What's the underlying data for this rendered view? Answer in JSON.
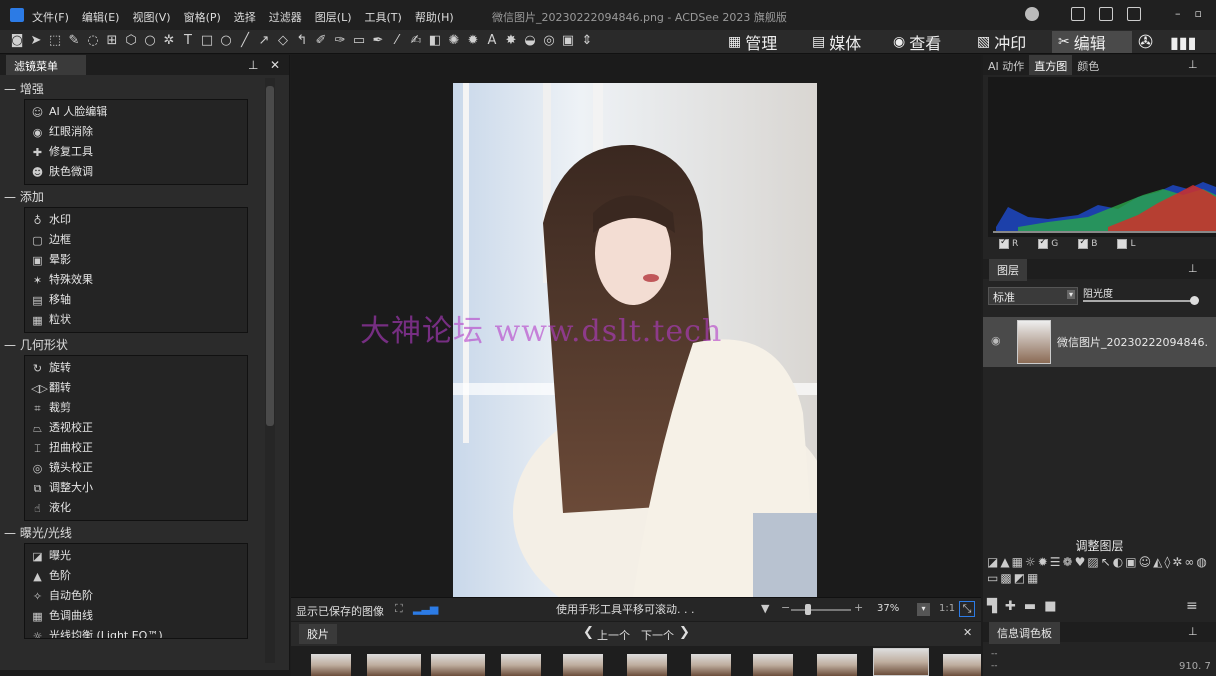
{
  "menubar": {
    "items": [
      "文件(F)",
      "编辑(E)",
      "视图(V)",
      "窗格(P)",
      "选择",
      "过滤器",
      "图层(L)",
      "工具(T)",
      "帮助(H)"
    ],
    "window_title": "微信图片_20230222094846.png - ACDSee 2023 旗舰版"
  },
  "modes": {
    "manage": "管理",
    "media": "媒体",
    "view": "查看",
    "develop": "冲印",
    "edit": "编辑"
  },
  "left_panel": {
    "tab": "滤镜菜单",
    "sections": [
      {
        "title": "增强",
        "items": [
          "AI 人脸编辑",
          "红眼消除",
          "修复工具",
          "肤色微调"
        ]
      },
      {
        "title": "添加",
        "items": [
          "水印",
          "边框",
          "晕影",
          "特殊效果",
          "移轴",
          "粒状"
        ]
      },
      {
        "title": "几何形状",
        "items": [
          "旋转",
          "翻转",
          "裁剪",
          "透视校正",
          "扭曲校正",
          "镜头校正",
          "调整大小",
          "液化"
        ]
      },
      {
        "title": "曝光/光线",
        "items": [
          "曝光",
          "色阶",
          "自动色阶",
          "色调曲线",
          "光线均衡 (Light EQ™)"
        ]
      }
    ]
  },
  "statusbar": {
    "show_saved": "显示已保存的图像",
    "hint": "使用手形工具平移可滚动. . .",
    "zoom": "37%",
    "ratio": "1:1"
  },
  "filmstrip": {
    "title": "胶片",
    "prev": "上一个",
    "next": "下一个"
  },
  "right_panel": {
    "tabs": [
      "AI 动作",
      "直方图",
      "颜色"
    ],
    "channels": [
      "R",
      "G",
      "B",
      "L"
    ],
    "layers_title": "图层",
    "blend_mode": "标准",
    "opacity_label": "阻光度",
    "layer_name": "微信图片_20230222094846.",
    "adjust_title": "调整图层",
    "info_title": "信息调色板",
    "info_value": "910. 7",
    "info_dash1": "--",
    "info_dash2": "--"
  },
  "watermark": "大神论坛    www.dslt.tech",
  "colors": {
    "accent": "#2c7be5",
    "panel": "#2b2b2b",
    "background": "#1b1b1b"
  }
}
